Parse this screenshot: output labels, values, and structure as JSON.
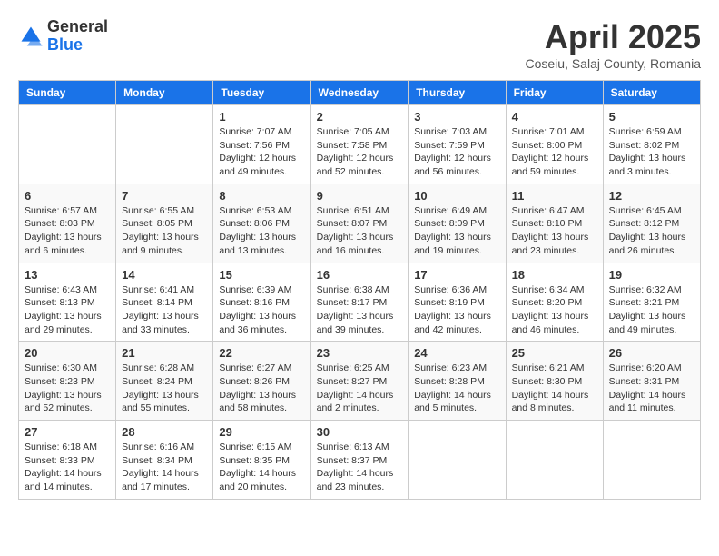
{
  "header": {
    "logo_general": "General",
    "logo_blue": "Blue",
    "title": "April 2025",
    "location": "Coseiu, Salaj County, Romania"
  },
  "calendar": {
    "days_of_week": [
      "Sunday",
      "Monday",
      "Tuesday",
      "Wednesday",
      "Thursday",
      "Friday",
      "Saturday"
    ],
    "weeks": [
      [
        {
          "day": "",
          "info": ""
        },
        {
          "day": "",
          "info": ""
        },
        {
          "day": "1",
          "info": "Sunrise: 7:07 AM\nSunset: 7:56 PM\nDaylight: 12 hours and 49 minutes."
        },
        {
          "day": "2",
          "info": "Sunrise: 7:05 AM\nSunset: 7:58 PM\nDaylight: 12 hours and 52 minutes."
        },
        {
          "day": "3",
          "info": "Sunrise: 7:03 AM\nSunset: 7:59 PM\nDaylight: 12 hours and 56 minutes."
        },
        {
          "day": "4",
          "info": "Sunrise: 7:01 AM\nSunset: 8:00 PM\nDaylight: 12 hours and 59 minutes."
        },
        {
          "day": "5",
          "info": "Sunrise: 6:59 AM\nSunset: 8:02 PM\nDaylight: 13 hours and 3 minutes."
        }
      ],
      [
        {
          "day": "6",
          "info": "Sunrise: 6:57 AM\nSunset: 8:03 PM\nDaylight: 13 hours and 6 minutes."
        },
        {
          "day": "7",
          "info": "Sunrise: 6:55 AM\nSunset: 8:05 PM\nDaylight: 13 hours and 9 minutes."
        },
        {
          "day": "8",
          "info": "Sunrise: 6:53 AM\nSunset: 8:06 PM\nDaylight: 13 hours and 13 minutes."
        },
        {
          "day": "9",
          "info": "Sunrise: 6:51 AM\nSunset: 8:07 PM\nDaylight: 13 hours and 16 minutes."
        },
        {
          "day": "10",
          "info": "Sunrise: 6:49 AM\nSunset: 8:09 PM\nDaylight: 13 hours and 19 minutes."
        },
        {
          "day": "11",
          "info": "Sunrise: 6:47 AM\nSunset: 8:10 PM\nDaylight: 13 hours and 23 minutes."
        },
        {
          "day": "12",
          "info": "Sunrise: 6:45 AM\nSunset: 8:12 PM\nDaylight: 13 hours and 26 minutes."
        }
      ],
      [
        {
          "day": "13",
          "info": "Sunrise: 6:43 AM\nSunset: 8:13 PM\nDaylight: 13 hours and 29 minutes."
        },
        {
          "day": "14",
          "info": "Sunrise: 6:41 AM\nSunset: 8:14 PM\nDaylight: 13 hours and 33 minutes."
        },
        {
          "day": "15",
          "info": "Sunrise: 6:39 AM\nSunset: 8:16 PM\nDaylight: 13 hours and 36 minutes."
        },
        {
          "day": "16",
          "info": "Sunrise: 6:38 AM\nSunset: 8:17 PM\nDaylight: 13 hours and 39 minutes."
        },
        {
          "day": "17",
          "info": "Sunrise: 6:36 AM\nSunset: 8:19 PM\nDaylight: 13 hours and 42 minutes."
        },
        {
          "day": "18",
          "info": "Sunrise: 6:34 AM\nSunset: 8:20 PM\nDaylight: 13 hours and 46 minutes."
        },
        {
          "day": "19",
          "info": "Sunrise: 6:32 AM\nSunset: 8:21 PM\nDaylight: 13 hours and 49 minutes."
        }
      ],
      [
        {
          "day": "20",
          "info": "Sunrise: 6:30 AM\nSunset: 8:23 PM\nDaylight: 13 hours and 52 minutes."
        },
        {
          "day": "21",
          "info": "Sunrise: 6:28 AM\nSunset: 8:24 PM\nDaylight: 13 hours and 55 minutes."
        },
        {
          "day": "22",
          "info": "Sunrise: 6:27 AM\nSunset: 8:26 PM\nDaylight: 13 hours and 58 minutes."
        },
        {
          "day": "23",
          "info": "Sunrise: 6:25 AM\nSunset: 8:27 PM\nDaylight: 14 hours and 2 minutes."
        },
        {
          "day": "24",
          "info": "Sunrise: 6:23 AM\nSunset: 8:28 PM\nDaylight: 14 hours and 5 minutes."
        },
        {
          "day": "25",
          "info": "Sunrise: 6:21 AM\nSunset: 8:30 PM\nDaylight: 14 hours and 8 minutes."
        },
        {
          "day": "26",
          "info": "Sunrise: 6:20 AM\nSunset: 8:31 PM\nDaylight: 14 hours and 11 minutes."
        }
      ],
      [
        {
          "day": "27",
          "info": "Sunrise: 6:18 AM\nSunset: 8:33 PM\nDaylight: 14 hours and 14 minutes."
        },
        {
          "day": "28",
          "info": "Sunrise: 6:16 AM\nSunset: 8:34 PM\nDaylight: 14 hours and 17 minutes."
        },
        {
          "day": "29",
          "info": "Sunrise: 6:15 AM\nSunset: 8:35 PM\nDaylight: 14 hours and 20 minutes."
        },
        {
          "day": "30",
          "info": "Sunrise: 6:13 AM\nSunset: 8:37 PM\nDaylight: 14 hours and 23 minutes."
        },
        {
          "day": "",
          "info": ""
        },
        {
          "day": "",
          "info": ""
        },
        {
          "day": "",
          "info": ""
        }
      ]
    ]
  }
}
